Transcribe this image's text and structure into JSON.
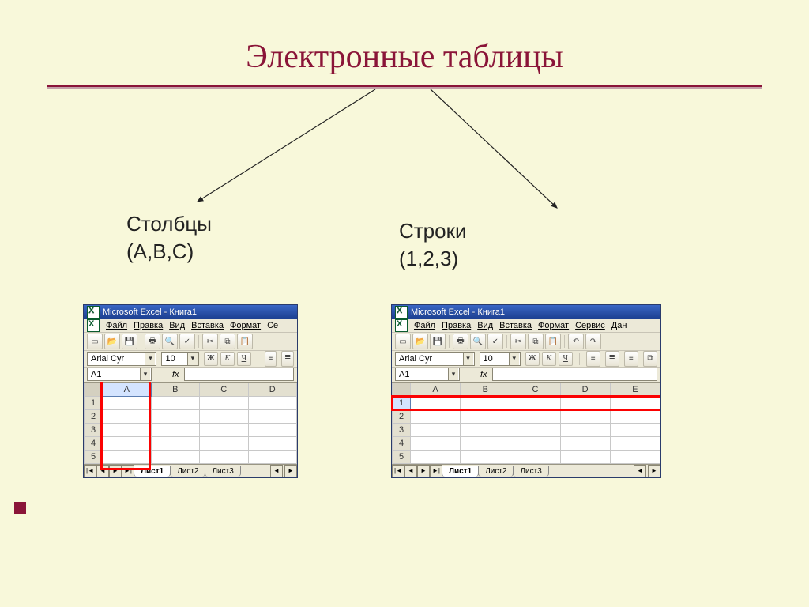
{
  "title": "Электронные таблицы",
  "labels": {
    "columns_title": "Столбцы",
    "columns_sub": "(А,В,С)",
    "rows_title": "Строки",
    "rows_sub": "(1,2,3)"
  },
  "excel": {
    "window_title": "Microsoft Excel - Книга1",
    "menu": {
      "file": "Файл",
      "edit": "Правка",
      "view": "Вид",
      "insert": "Вставка",
      "format": "Формат",
      "tools": "Сервис",
      "data": "Дан"
    },
    "menu_trunc_left": "Се",
    "format_bar": {
      "font": "Arial Cyr",
      "size": "10",
      "bold": "Ж",
      "italic": "К",
      "underline": "Ч"
    },
    "fx_bar": {
      "cell_ref": "A1",
      "fx": "fx"
    },
    "columns_left": [
      "A",
      "B",
      "C",
      "D"
    ],
    "columns_right": [
      "A",
      "B",
      "C",
      "D",
      "E"
    ],
    "rows": [
      "1",
      "2",
      "3",
      "4",
      "5"
    ],
    "sheet_tabs": {
      "s1": "Лист1",
      "s2": "Лист2",
      "s3": "Лист3"
    },
    "nav": {
      "first": "|◄",
      "prev": "◄",
      "next": "►",
      "last": "►|"
    }
  }
}
